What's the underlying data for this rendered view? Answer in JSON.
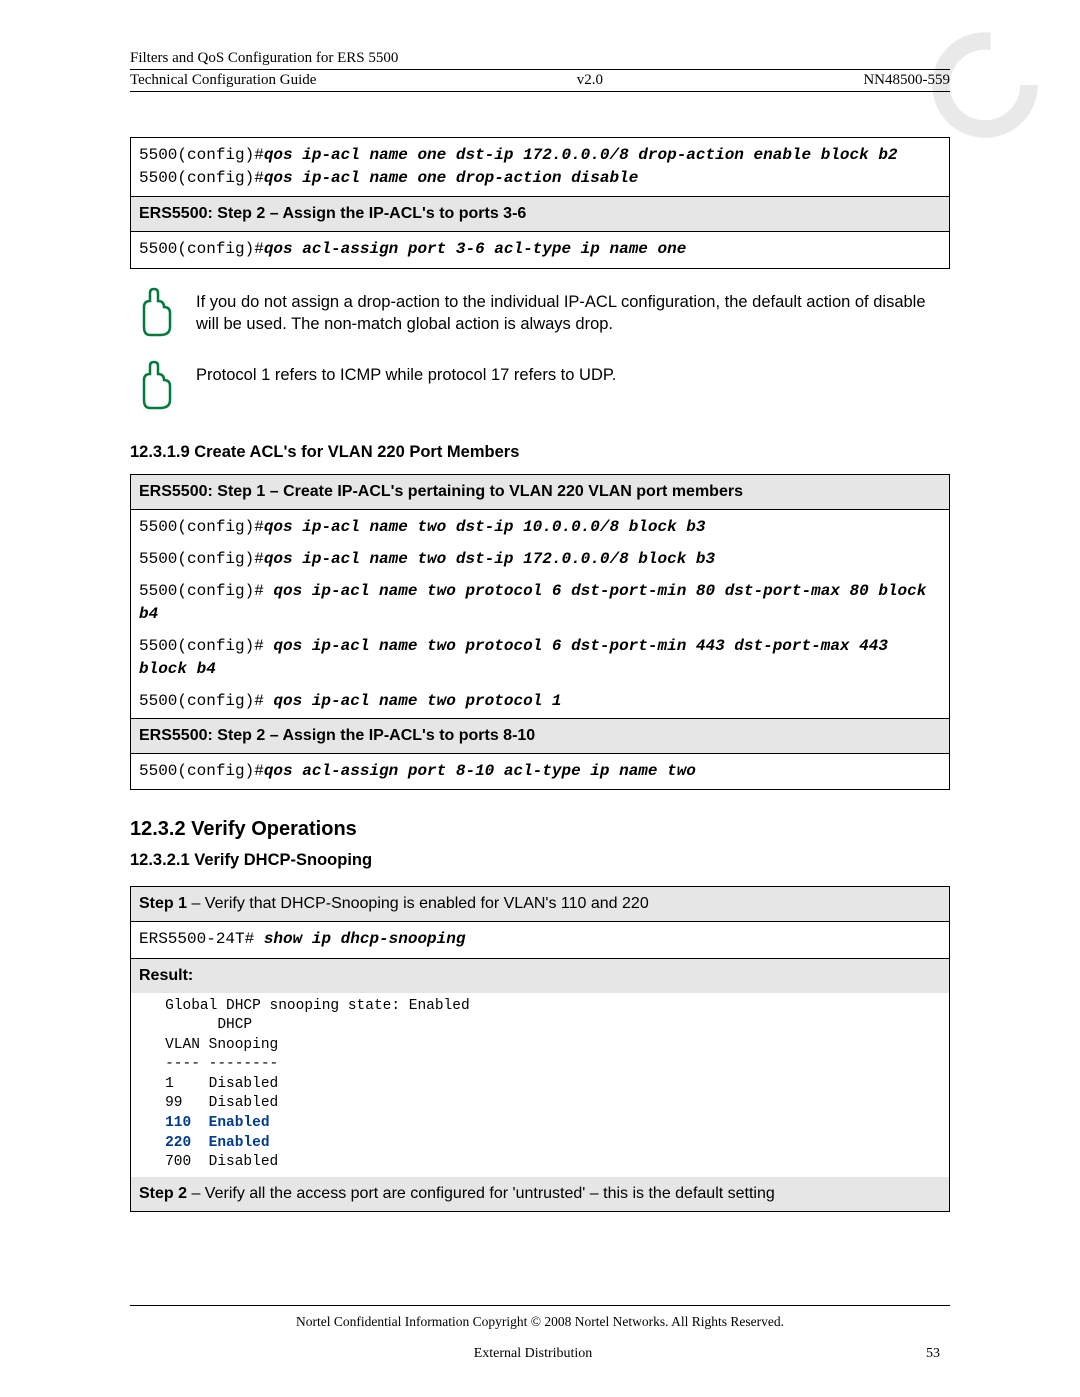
{
  "header": {
    "title_line1": "Filters and QoS Configuration for ERS 5500",
    "title_line2_left": "Technical Configuration Guide",
    "version": "v2.0",
    "doc_number": "NN48500-559"
  },
  "block1": {
    "line1_prompt": "5500(config)#",
    "line1_cmd": "qos ip-acl name one dst-ip 172.0.0.0/8 drop-action enable block b2",
    "line2_prompt": "5500(config)#",
    "line2_cmd": "qos ip-acl name one drop-action disable"
  },
  "step_a": "ERS5500: Step 2 – Assign the IP-ACL's to ports 3-6",
  "block2": {
    "prompt": "5500(config)#",
    "cmd": "qos acl-assign port 3-6 acl-type ip name one"
  },
  "note1": "If you do not assign a drop-action to the individual IP-ACL configuration, the default action of disable will be used. The non-match global action is always drop.",
  "note2": "Protocol 1 refers to ICMP while protocol 17 refers to UDP.",
  "section_12319": "12.3.1.9  Create ACL's for VLAN 220 Port Members",
  "step_b": "ERS5500: Step 1 – Create IP-ACL's pertaining to VLAN 220 VLAN port members",
  "block3": {
    "l1p": "5500(config)#",
    "l1c": "qos ip-acl name two dst-ip 10.0.0.0/8 block b3",
    "l2p": "5500(config)#",
    "l2c": "qos ip-acl name two dst-ip 172.0.0.0/8 block b3",
    "l3p": "5500(config)# ",
    "l3c": "qos ip-acl name two protocol 6 dst-port-min 80 dst-port-max 80 block b4",
    "l4p": "5500(config)# ",
    "l4c": "qos ip-acl name two protocol 6 dst-port-min 443 dst-port-max 443 block b4",
    "l5p": "5500(config)# ",
    "l5c": "qos ip-acl name two protocol 1"
  },
  "step_c": "ERS5500: Step 2 – Assign the IP-ACL's to ports 8-10",
  "block4": {
    "prompt": "5500(config)#",
    "cmd": "qos acl-assign port 8-10 acl-type ip name two"
  },
  "h1232": "12.3.2 Verify Operations",
  "sub_12321": "12.3.2.1  Verify DHCP-Snooping",
  "step_d_label": "Step 1",
  "step_d_rest": " – Verify that DHCP-Snooping is enabled for VLAN's 110 and 220",
  "block5": {
    "prompt": "ERS5500-24T# ",
    "cmd": "show ip dhcp-snooping"
  },
  "result_label": "Result:",
  "result_body": {
    "line1": "Global DHCP snooping state: Enabled",
    "line2": "      DHCP",
    "line3": "VLAN Snooping",
    "line4": "---- --------",
    "r1": "1    Disabled",
    "r2": "99   Disabled",
    "r3": "110  Enabled",
    "r4": "220  Enabled",
    "r5": "700  Disabled"
  },
  "step_e_label": "Step 2",
  "step_e_rest": " – Verify all the access port are configured for 'untrusted' – this is the default setting",
  "footer": {
    "copyright": "Nortel Confidential Information   Copyright © 2008 Nortel Networks. All Rights Reserved.",
    "dist": "External Distribution",
    "page": "53"
  }
}
